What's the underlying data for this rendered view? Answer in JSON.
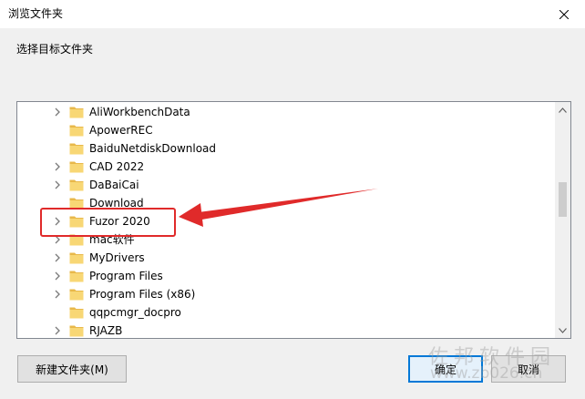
{
  "window": {
    "title": "浏览文件夹",
    "close_icon": "close-icon"
  },
  "prompt": "选择目标文件夹",
  "tree": {
    "items": [
      {
        "label": "AliWorkbenchData",
        "expandable": true
      },
      {
        "label": "ApowerREC",
        "expandable": false
      },
      {
        "label": "BaiduNetdiskDownload",
        "expandable": false
      },
      {
        "label": "CAD 2022",
        "expandable": true
      },
      {
        "label": "DaBaiCai",
        "expandable": true
      },
      {
        "label": "Download",
        "expandable": false
      },
      {
        "label": "Fuzor 2020",
        "expandable": true
      },
      {
        "label": "mac软件",
        "expandable": true
      },
      {
        "label": "MyDrivers",
        "expandable": true
      },
      {
        "label": "Program Files",
        "expandable": true
      },
      {
        "label": "Program Files (x86)",
        "expandable": true
      },
      {
        "label": "qqpcmgr_docpro",
        "expandable": false
      },
      {
        "label": "RJAZB",
        "expandable": true
      }
    ],
    "highlighted_item": "Fuzor 2020"
  },
  "buttons": {
    "new_folder": "新建文件夹(M)",
    "ok": "确定",
    "cancel": "取消"
  },
  "watermark": {
    "line1": "佐邦软件园",
    "line2": "www.zb026.cn"
  },
  "colors": {
    "folder": "#f8d775",
    "folder_dark": "#e8b84a",
    "annotation": "#e02a2a",
    "accent": "#0078d7"
  }
}
